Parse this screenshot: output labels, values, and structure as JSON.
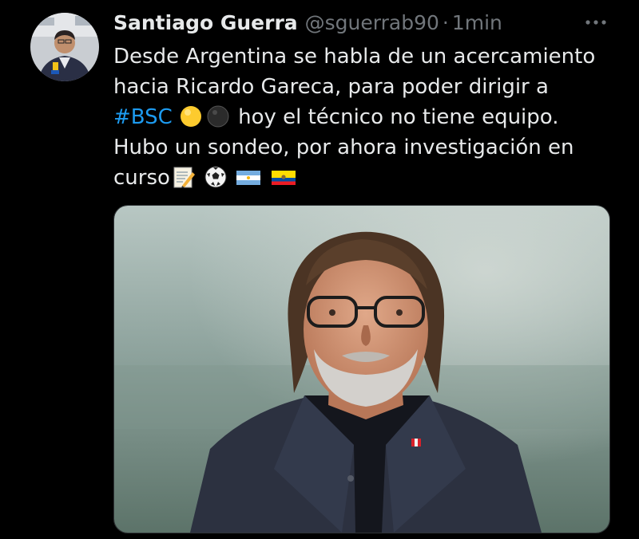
{
  "tweet": {
    "author": {
      "display_name": "Santiago Guerra",
      "handle": "@sguerrab90",
      "avatar_icon": "profile-photo"
    },
    "separator": "·",
    "timestamp": "1min",
    "more_icon": "more-horizontal-icon",
    "text": {
      "line1": "Desde Argentina se habla de un acercamiento",
      "line2": "hacia Ricardo Gareca, para poder dirigir a",
      "hashtag": "#BSC",
      "line3_rest": " hoy el técnico no tiene equipo.",
      "line4": "Hubo un sondeo, por ahora investigación en",
      "line5": "curso"
    },
    "emojis": [
      "yellow-circle",
      "black-circle",
      "memo",
      "soccer-ball",
      "argentina-flag",
      "ecuador-flag"
    ],
    "media": {
      "type": "photo",
      "icon": "coach-portrait-photo"
    }
  },
  "colors": {
    "background": "#000000",
    "text": "#e7e9ea",
    "secondary": "#71767b",
    "link": "#1d9bf0"
  }
}
